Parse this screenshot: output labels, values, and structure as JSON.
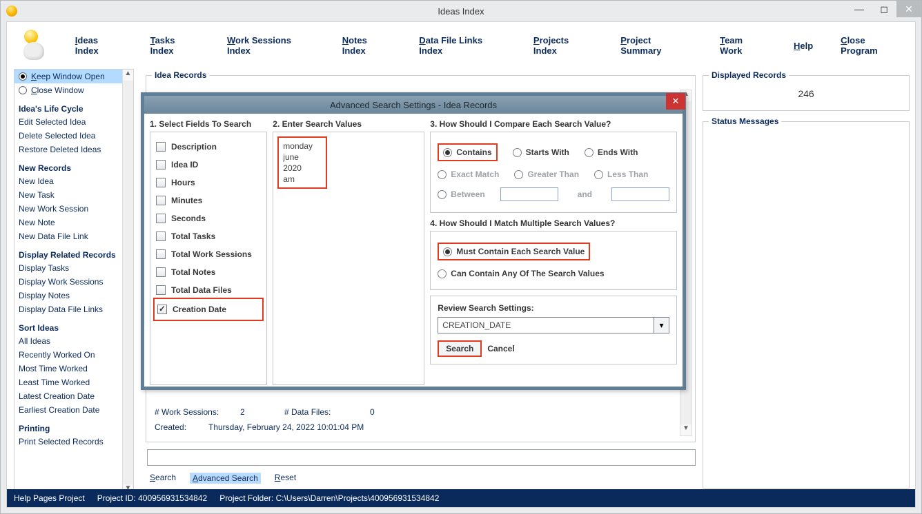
{
  "window": {
    "title": "Ideas Index"
  },
  "topnav": {
    "items": [
      {
        "u": "I",
        "rest": "deas Index"
      },
      {
        "u": "T",
        "rest": "asks Index"
      },
      {
        "u": "W",
        "rest": "ork Sessions Index"
      },
      {
        "u": "N",
        "rest": "otes Index"
      },
      {
        "u": "D",
        "rest": "ata File Links Index"
      },
      {
        "u": "P",
        "rest": "rojects Index"
      },
      {
        "u": "P",
        "rest": "roject Summary"
      },
      {
        "u": "T",
        "rest": "eam Work"
      },
      {
        "u": "H",
        "rest": "elp"
      },
      {
        "u": "C",
        "rest": "lose Program"
      }
    ]
  },
  "leftpanel": {
    "window_opts": {
      "keep": {
        "u": "K",
        "rest": "eep Window Open",
        "selected": true
      },
      "close": {
        "u": "C",
        "rest": "lose Window",
        "selected": false
      }
    },
    "groups": [
      {
        "heading": "Idea's Life Cycle",
        "links": [
          "Edit Selected Idea",
          "Delete Selected Idea",
          "Restore Deleted Ideas"
        ]
      },
      {
        "heading": "New Records",
        "links": [
          "New Idea",
          "New Task",
          "New Work Session",
          "New Note",
          "New Data File Link"
        ]
      },
      {
        "heading": "Display Related Records",
        "links": [
          "Display Tasks",
          "Display Work Sessions",
          "Display Notes",
          "Display Data File Links"
        ]
      },
      {
        "heading": "Sort Ideas",
        "links": [
          "All Ideas",
          "Recently Worked On",
          "Most Time Worked",
          "Least Time Worked",
          "Latest Creation Date",
          "Earliest Creation Date"
        ]
      },
      {
        "heading": "Printing",
        "links": [
          "Print Selected Records"
        ]
      }
    ]
  },
  "records": {
    "legend": "Idea Records",
    "detail": {
      "work_sessions_label": "# Work Sessions:",
      "work_sessions": "2",
      "data_files_label": "# Data Files:",
      "data_files": "0",
      "created_label": "Created:",
      "created": "Thursday, February 24, 2022   10:01:04 PM"
    }
  },
  "bottom_tabs": {
    "search": {
      "u": "S",
      "rest": "earch"
    },
    "advanced": {
      "u": "A",
      "rest": "dvanced Search",
      "active": true
    },
    "reset": {
      "u": "R",
      "rest": "eset"
    }
  },
  "right": {
    "displayed_legend": "Displayed Records",
    "count": "246",
    "status_legend": "Status Messages"
  },
  "statusbar": {
    "help": "Help Pages Project",
    "project_id_label": "Project ID:",
    "project_id": "400956931534842",
    "folder_label": "Project Folder:",
    "folder": "C:\\Users\\Darren\\Projects\\400956931534842"
  },
  "dialog": {
    "title": "Advanced Search Settings - Idea Records",
    "col1_head": "1. Select Fields To Search",
    "col2_head": "2. Enter Search Values",
    "col3_head": "3. How Should I Compare Each Search Value?",
    "row4_head": "4. How Should I Match Multiple Search Values?",
    "review_head": "Review Search Settings:",
    "fields": [
      {
        "label": "Description",
        "checked": false
      },
      {
        "label": "Idea ID",
        "checked": false
      },
      {
        "label": "Hours",
        "checked": false
      },
      {
        "label": "Minutes",
        "checked": false
      },
      {
        "label": "Seconds",
        "checked": false
      },
      {
        "label": "Total Tasks",
        "checked": false
      },
      {
        "label": "Total Work Sessions",
        "checked": false
      },
      {
        "label": "Total Notes",
        "checked": false
      },
      {
        "label": "Total Data Files",
        "checked": false
      },
      {
        "label": "Creation Date",
        "checked": true,
        "highlight": true
      }
    ],
    "values_text": "monday\njune\n2020\nam",
    "compare": {
      "contains": "Contains",
      "starts": "Starts With",
      "ends": "Ends With",
      "exact": "Exact Match",
      "gt": "Greater Than",
      "lt": "Less Than",
      "between": "Between",
      "and": "and"
    },
    "match": {
      "each": "Must Contain Each Search Value",
      "any": "Can Contain Any Of The Search Values"
    },
    "review_value": "CREATION_DATE",
    "btn_search": "Search",
    "btn_cancel": "Cancel"
  }
}
